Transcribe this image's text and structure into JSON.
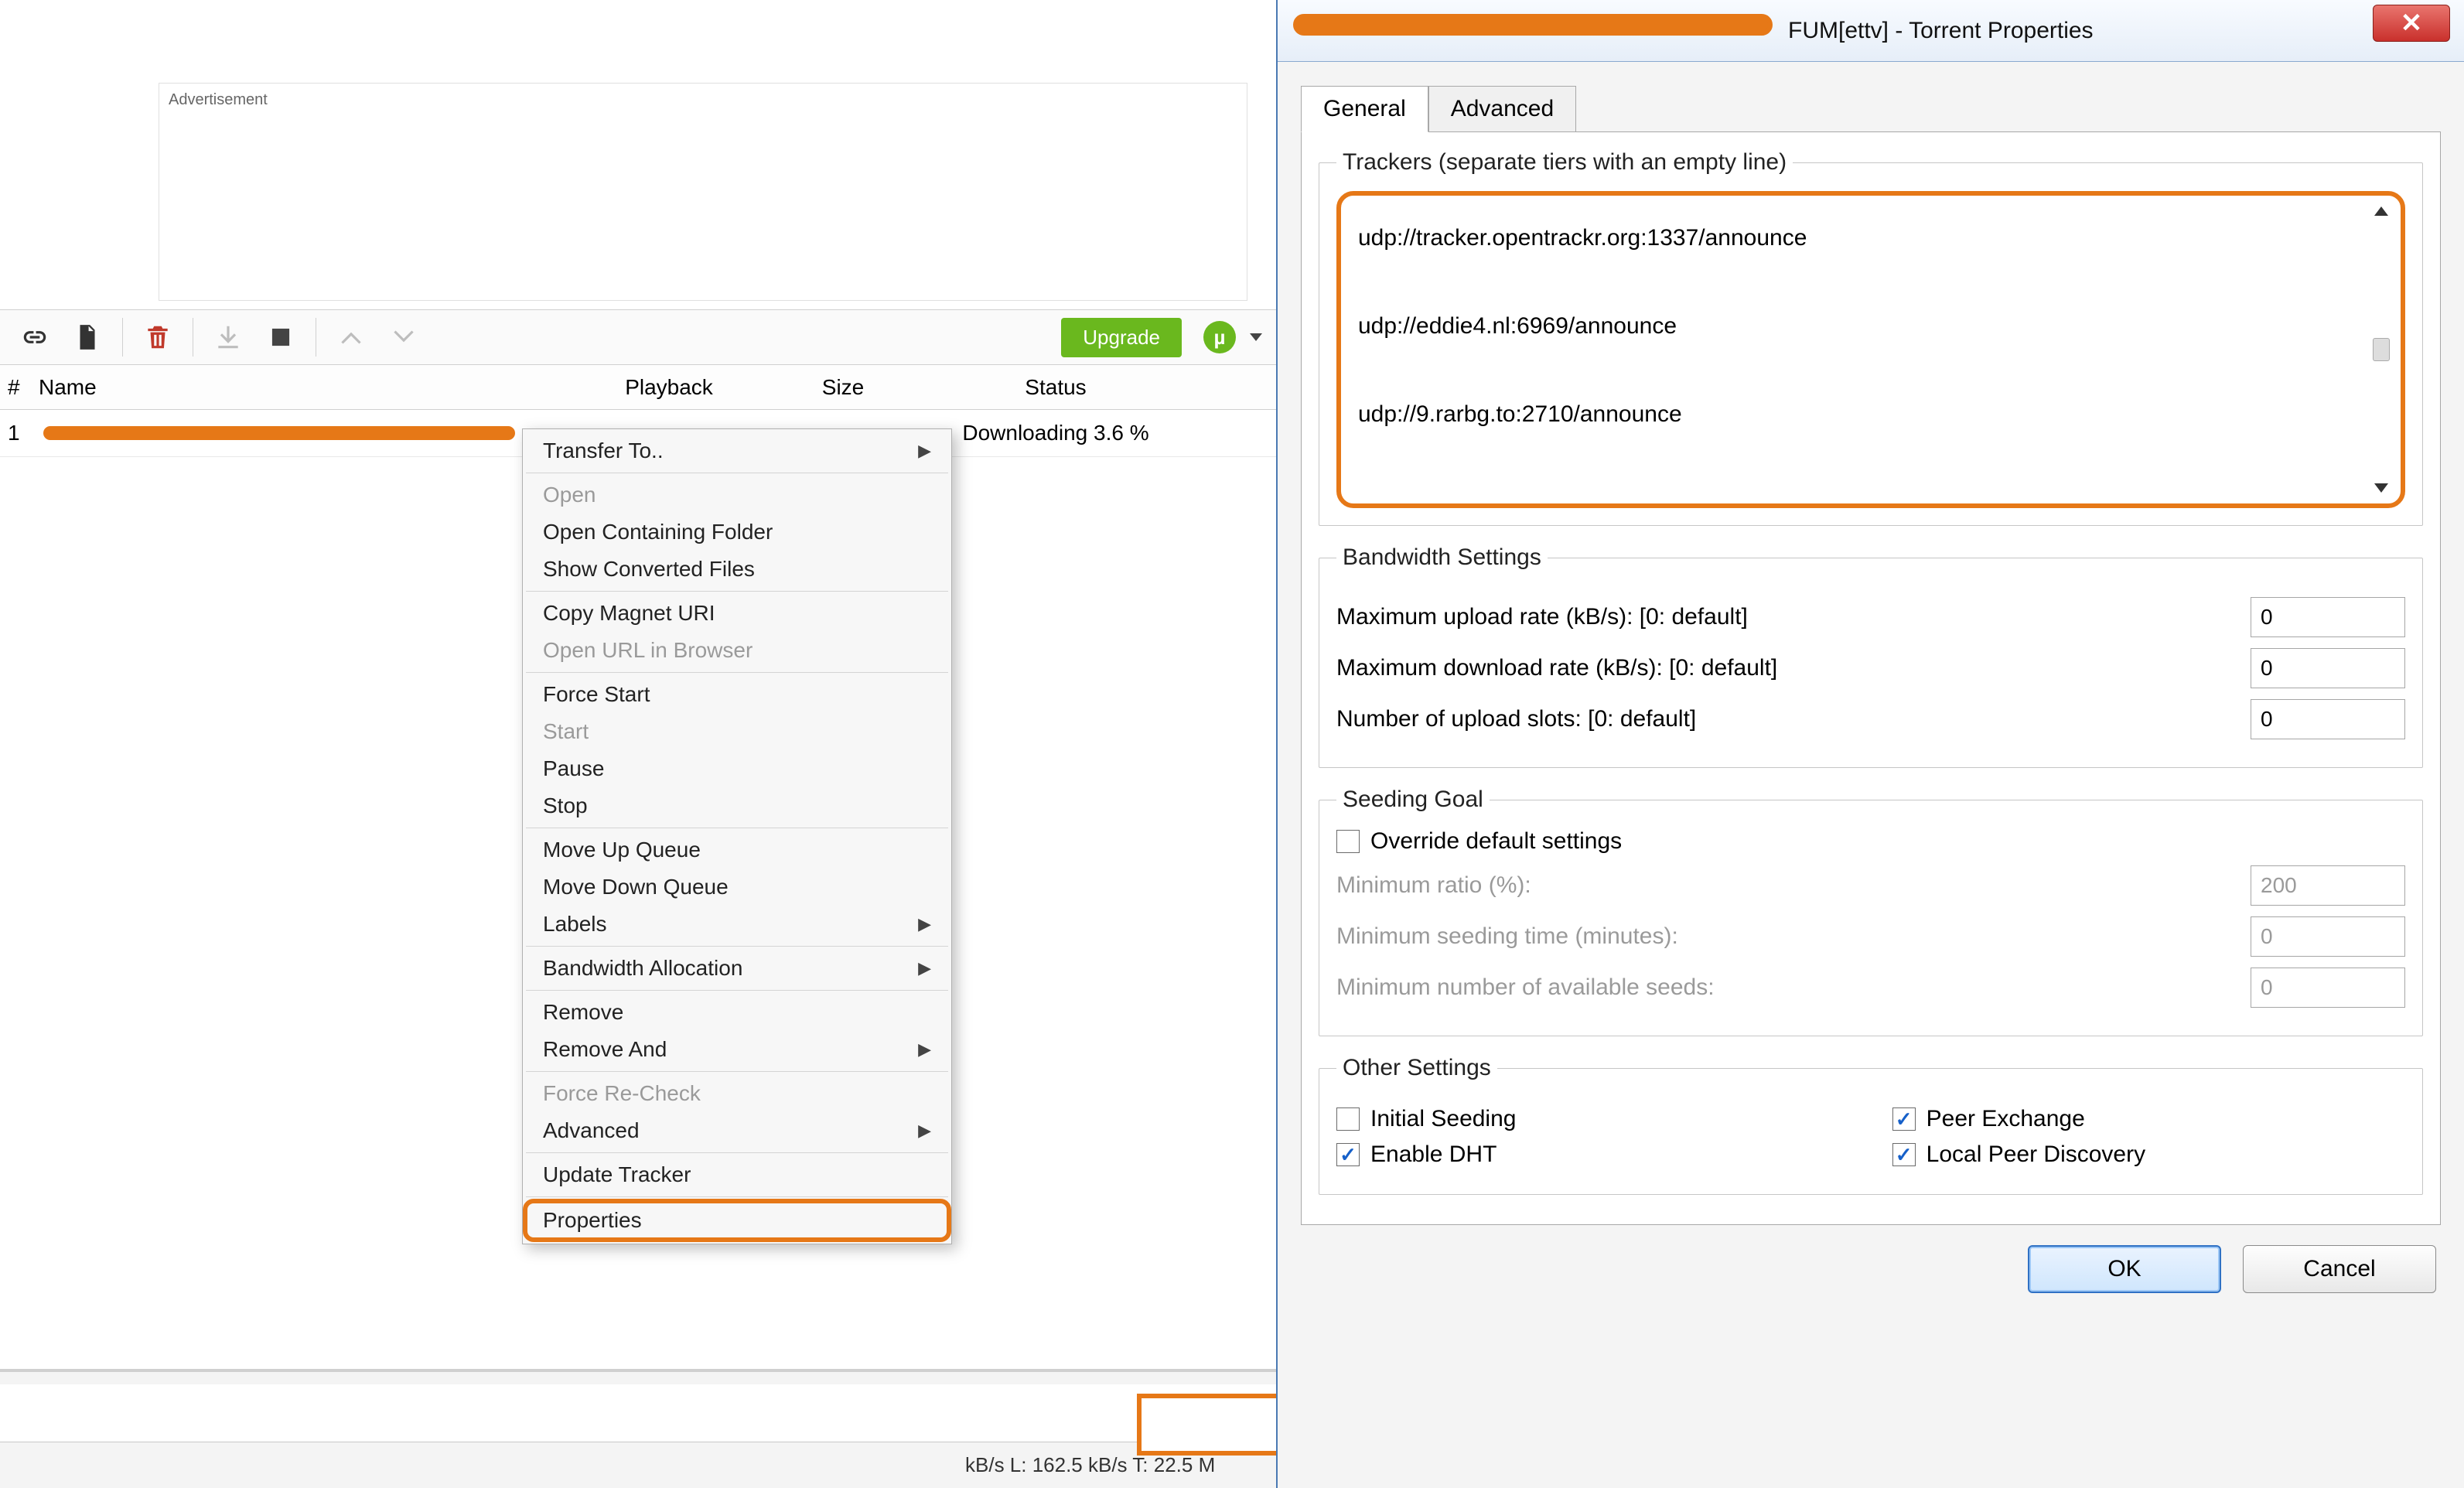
{
  "ad_label": "Advertisement",
  "toolbar": {
    "upgrade": "Upgrade"
  },
  "columns": {
    "num": "#",
    "name": "Name",
    "playback": "Playback",
    "size": "Size",
    "status": "Status"
  },
  "row": {
    "index": "1",
    "status": "Downloading 3.6 %"
  },
  "statusbar": "kB/s L: 162.5 kB/s T: 22.5 M",
  "ctx": {
    "transfer_to": "Transfer To..",
    "open": "Open",
    "open_containing": "Open Containing Folder",
    "show_converted": "Show Converted Files",
    "copy_magnet": "Copy Magnet URI",
    "open_url": "Open URL in Browser",
    "force_start": "Force Start",
    "start": "Start",
    "pause": "Pause",
    "stop": "Stop",
    "move_up": "Move Up Queue",
    "move_down": "Move Down Queue",
    "labels": "Labels",
    "bw_alloc": "Bandwidth Allocation",
    "remove": "Remove",
    "remove_and": "Remove And",
    "force_recheck": "Force Re-Check",
    "advanced": "Advanced",
    "update_tracker": "Update Tracker",
    "properties": "Properties"
  },
  "dialog": {
    "title_suffix": "FUM[ettv] - Torrent Properties",
    "tab_general": "General",
    "tab_advanced": "Advanced",
    "trackers_legend": "Trackers (separate tiers with an empty line)",
    "trackers": {
      "t1": "udp://tracker.opentrackr.org:1337/announce",
      "t2": "udp://eddie4.nl:6969/announce",
      "t3": "udp://9.rarbg.to:2710/announce"
    },
    "bw_legend": "Bandwidth Settings",
    "max_up_label": "Maximum upload rate (kB/s): [0: default]",
    "max_up_val": "0",
    "max_down_label": "Maximum download rate (kB/s): [0: default]",
    "max_down_val": "0",
    "slots_label": "Number of upload slots: [0: default]",
    "slots_val": "0",
    "seed_legend": "Seeding Goal",
    "override_label": "Override default settings",
    "min_ratio_label": "Minimum ratio (%):",
    "min_ratio_val": "200",
    "min_time_label": "Minimum seeding time (minutes):",
    "min_time_val": "0",
    "min_seeds_label": "Minimum number of available seeds:",
    "min_seeds_val": "0",
    "other_legend": "Other Settings",
    "initial_seeding": "Initial Seeding",
    "peer_exchange": "Peer Exchange",
    "enable_dht": "Enable DHT",
    "local_peer": "Local Peer Discovery",
    "ok": "OK",
    "cancel": "Cancel"
  }
}
